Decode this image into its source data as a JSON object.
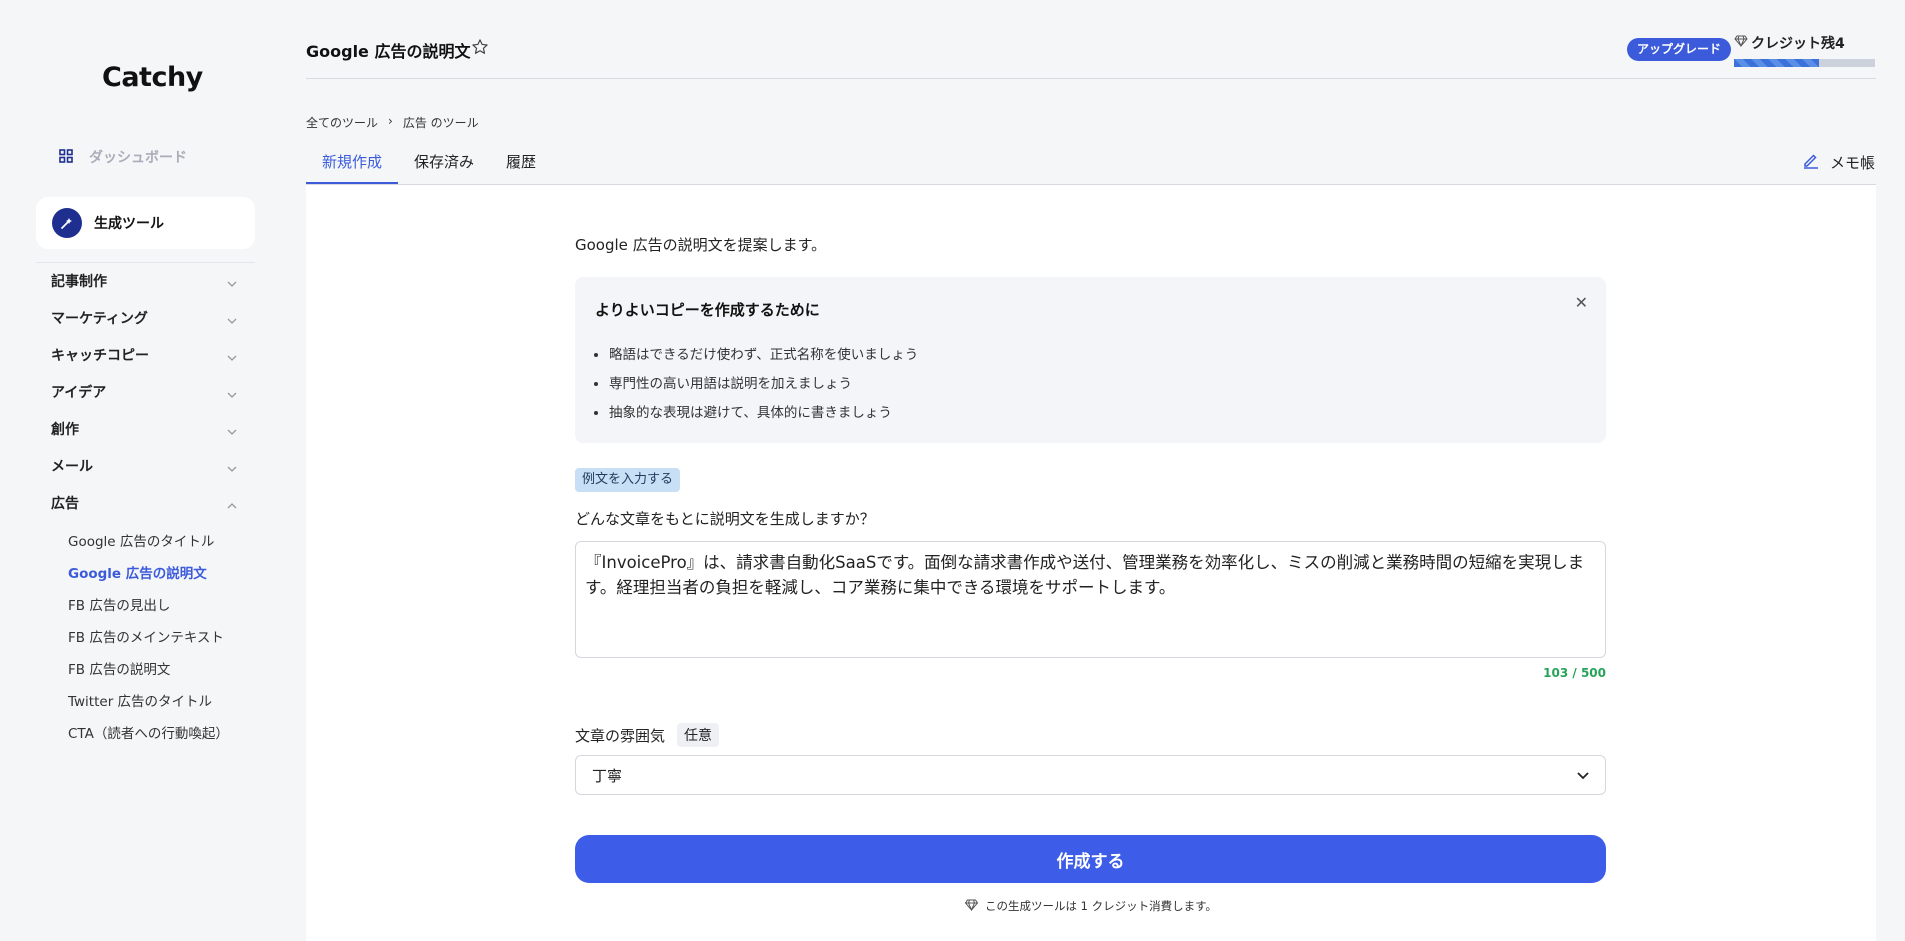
{
  "sidebar": {
    "logo": "Catchy",
    "dashboard": "ダッシュボード",
    "generator": "生成ツール",
    "categories": [
      "記事制作",
      "マーケティング",
      "キャッチコピー",
      "アイデア",
      "創作",
      "メール",
      "広告"
    ],
    "ad_items": [
      "Google 広告のタイトル",
      "Google 広告の説明文",
      "FB 広告の見出し",
      "FB 広告のメインテキスト",
      "FB 広告の説明文",
      "Twitter 広告のタイトル",
      "CTA（読者への行動喚起）"
    ]
  },
  "header": {
    "title": "Google 広告の説明文",
    "upgrade": "アップグレード",
    "credit": "クレジット残4",
    "credit_progress": 0.6
  },
  "breadcrumb": [
    "全てのツール",
    "›",
    "広告 のツール"
  ],
  "tabs": [
    "新規作成",
    "保存済み",
    "履歴"
  ],
  "memo": "メモ帳",
  "main": {
    "intro": "Google 広告の説明文を提案します。",
    "tips_title": "よりよいコピーを作成するために",
    "tips": [
      "略語はできるだけ使わず、正式名称を使いましょう",
      "専門性の高い用語は説明を加えましょう",
      "抽象的な表現は避けて、具体的に書きましょう"
    ],
    "sample_button": "例文を入力する",
    "question": "どんな文章をもとに説明文を生成しますか？",
    "textarea_value": "『InvoicePro』は、請求書自動化SaaSです。面倒な請求書作成や送付、管理業務を効率化し、ミスの削減と業務時間の短縮を実現します。経理担当者の負担を軽減し、コア業務に集中できる環境をサポートします。",
    "char_count": "103 / 500",
    "mood_label": "文章の雰囲気",
    "mood_optional": "任意",
    "mood_value": "丁寧",
    "create_button": "作成する",
    "credit_note": "この生成ツールは 1 クレジット消費します。"
  }
}
